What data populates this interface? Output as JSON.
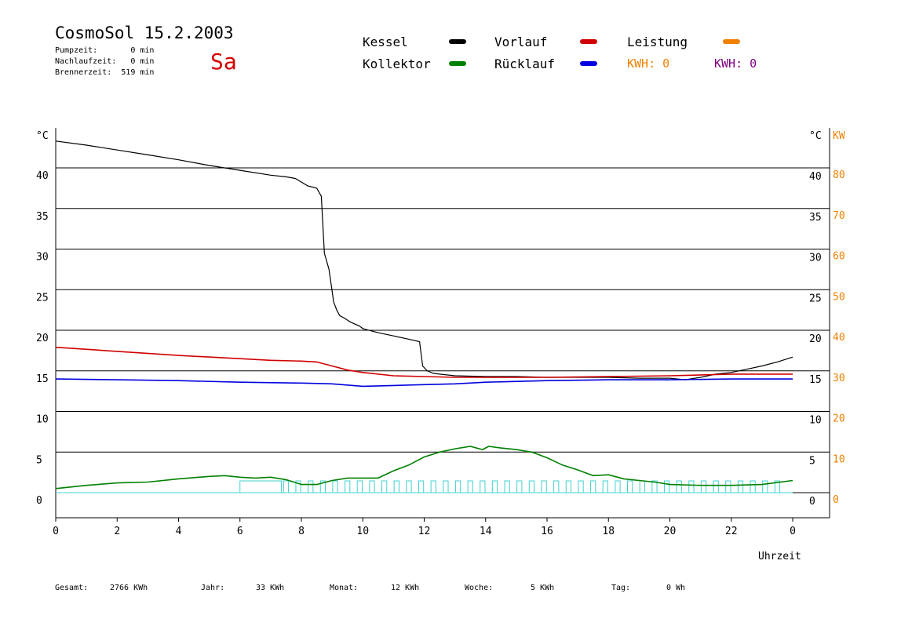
{
  "header": {
    "title": "CosmoSol 15.2.2003",
    "day": "Sa",
    "pumpzeit": "Pumpzeit:       0 min",
    "nachlaufzeit": "Nachlaufzeit:   0 min",
    "brennerzeit": "Brennerzeit:  519 min"
  },
  "legend": {
    "kessel": "Kessel",
    "kollektor": "Kollektor",
    "vorlauf": "Vorlauf",
    "ruecklauf": "Rücklauf",
    "leistung": "Leistung",
    "kwh1": "KWH: 0",
    "kwh2": "KWH: 0"
  },
  "colors": {
    "kessel": "#000000",
    "kollektor": "#008000",
    "vorlauf": "#d00000",
    "ruecklauf": "#0000e0",
    "leistung": "#f08000",
    "kwh2": "#800080",
    "pump": "#40d0d0"
  },
  "totals": {
    "gesamt_label": "Gesamt:",
    "gesamt_value": "2766 KWh",
    "jahr_label": "Jahr:",
    "jahr_value": "33 KWh",
    "monat_label": "Monat:",
    "monat_value": "12 KWh",
    "woche_label": "Woche:",
    "woche_value": "5 KWh",
    "tag_label": "Tag:",
    "tag_value": "0 Wh"
  },
  "chart_data": {
    "type": "line",
    "xlabel": "Uhrzeit",
    "ylabel_left": "°C",
    "ylabel_right": "°C",
    "ylabel_right2": "KW",
    "xlim": [
      0,
      24
    ],
    "ylim": [
      0,
      45
    ],
    "grid": true,
    "x_ticks": [
      0,
      2,
      4,
      6,
      8,
      10,
      12,
      14,
      16,
      18,
      20,
      22,
      24
    ],
    "x_tick_labels": [
      "0",
      "2",
      "4",
      "6",
      "8",
      "10",
      "12",
      "14",
      "16",
      "18",
      "20",
      "22",
      "0"
    ],
    "y_ticks": [
      0,
      5,
      10,
      15,
      20,
      25,
      30,
      35,
      40
    ],
    "y_tick_labels": [
      "0",
      "5",
      "10",
      "15",
      "20",
      "25",
      "30",
      "35",
      "40"
    ],
    "y2_tick_labels": [
      "0",
      "10",
      "20",
      "30",
      "40",
      "50",
      "60",
      "70",
      "80"
    ],
    "series": [
      {
        "name": "Kessel",
        "x": [
          0,
          1,
          2,
          3,
          4,
          5,
          6,
          7,
          7.5,
          7.8,
          8.2,
          8.5,
          8.65,
          8.75,
          8.9,
          9.05,
          9.15,
          9.25,
          9.4,
          9.6,
          9.9,
          10.0,
          10.5,
          11.0,
          11.5,
          11.85,
          11.95,
          12.1,
          12.3,
          12.5,
          13,
          14,
          15,
          16,
          17,
          18,
          19,
          20,
          20.5,
          21,
          21.5,
          22,
          22.5,
          23,
          23.5,
          24
        ],
        "y": [
          43.3,
          42.8,
          42.2,
          41.6,
          41.0,
          40.3,
          39.7,
          39.1,
          38.9,
          38.7,
          37.8,
          37.5,
          36.5,
          29.5,
          27.5,
          23.5,
          22.5,
          21.8,
          21.5,
          21.0,
          20.5,
          20.2,
          19.7,
          19.3,
          18.9,
          18.6,
          15.6,
          15.0,
          14.7,
          14.6,
          14.4,
          14.3,
          14.3,
          14.2,
          14.2,
          14.2,
          14.1,
          14.1,
          13.9,
          14.2,
          14.6,
          14.8,
          15.2,
          15.6,
          16.1,
          16.7
        ]
      },
      {
        "name": "Vorlauf",
        "x": [
          0,
          2,
          4,
          6,
          7,
          8,
          8.5,
          9,
          9.5,
          10,
          11,
          12,
          13,
          14,
          16,
          18,
          20,
          22,
          24
        ],
        "y": [
          17.9,
          17.4,
          16.9,
          16.5,
          16.3,
          16.2,
          16.1,
          15.6,
          15.1,
          14.8,
          14.4,
          14.3,
          14.2,
          14.2,
          14.2,
          14.3,
          14.4,
          14.6,
          14.6
        ]
      },
      {
        "name": "Rücklauf",
        "x": [
          0,
          2,
          4,
          6,
          8,
          9,
          10,
          11,
          12,
          13,
          14,
          16,
          18,
          20,
          22,
          24
        ],
        "y": [
          14.0,
          13.9,
          13.8,
          13.6,
          13.5,
          13.4,
          13.1,
          13.2,
          13.3,
          13.4,
          13.6,
          13.8,
          13.9,
          13.9,
          14.0,
          14.0
        ]
      },
      {
        "name": "Kollektor",
        "x": [
          0,
          1,
          2,
          3,
          4,
          5,
          5.5,
          6,
          6.5,
          7,
          7.5,
          8,
          8.5,
          9,
          9.5,
          10,
          10.5,
          11,
          11.5,
          12,
          12.5,
          13,
          13.5,
          13.9,
          14.1,
          14.5,
          15,
          15.5,
          16,
          16.5,
          17,
          17.5,
          18,
          18.5,
          19,
          19.5,
          20,
          21,
          22,
          23,
          24
        ],
        "y": [
          0.5,
          0.9,
          1.2,
          1.3,
          1.7,
          2.0,
          2.1,
          1.9,
          1.8,
          1.9,
          1.6,
          1.0,
          1.0,
          1.5,
          1.8,
          1.8,
          1.8,
          2.7,
          3.4,
          4.4,
          5.0,
          5.4,
          5.7,
          5.3,
          5.7,
          5.5,
          5.3,
          5.0,
          4.3,
          3.4,
          2.8,
          2.1,
          2.2,
          1.7,
          1.5,
          1.3,
          1.0,
          0.9,
          0.9,
          1.0,
          1.5
        ]
      }
    ],
    "pump_blocks": {
      "name": "Pumpe",
      "ranges": [
        [
          6.0,
          7.35
        ],
        [
          7.42,
          7.58
        ],
        [
          7.82,
          7.98
        ],
        [
          8.22,
          8.38
        ],
        [
          8.62,
          8.78
        ],
        [
          9.02,
          9.18
        ],
        [
          9.42,
          9.58
        ],
        [
          9.82,
          9.98
        ],
        [
          10.22,
          10.38
        ],
        [
          10.62,
          10.78
        ],
        [
          11.02,
          11.18
        ],
        [
          11.42,
          11.58
        ],
        [
          11.82,
          11.98
        ],
        [
          12.22,
          12.38
        ],
        [
          12.62,
          12.78
        ],
        [
          13.02,
          13.18
        ],
        [
          13.42,
          13.58
        ],
        [
          13.82,
          13.98
        ],
        [
          14.22,
          14.38
        ],
        [
          14.62,
          14.78
        ],
        [
          15.02,
          15.18
        ],
        [
          15.42,
          15.58
        ],
        [
          15.82,
          15.98
        ],
        [
          16.22,
          16.38
        ],
        [
          16.62,
          16.78
        ],
        [
          17.02,
          17.18
        ],
        [
          17.42,
          17.58
        ],
        [
          17.82,
          17.98
        ],
        [
          18.22,
          18.38
        ],
        [
          18.62,
          18.78
        ],
        [
          19.02,
          19.18
        ],
        [
          19.42,
          19.58
        ],
        [
          19.82,
          19.98
        ],
        [
          20.22,
          20.38
        ],
        [
          20.62,
          20.78
        ],
        [
          21.02,
          21.18
        ],
        [
          21.42,
          21.58
        ],
        [
          21.82,
          21.98
        ],
        [
          22.22,
          22.38
        ],
        [
          22.62,
          22.78
        ],
        [
          23.02,
          23.18
        ],
        [
          23.42,
          23.58
        ]
      ]
    }
  }
}
